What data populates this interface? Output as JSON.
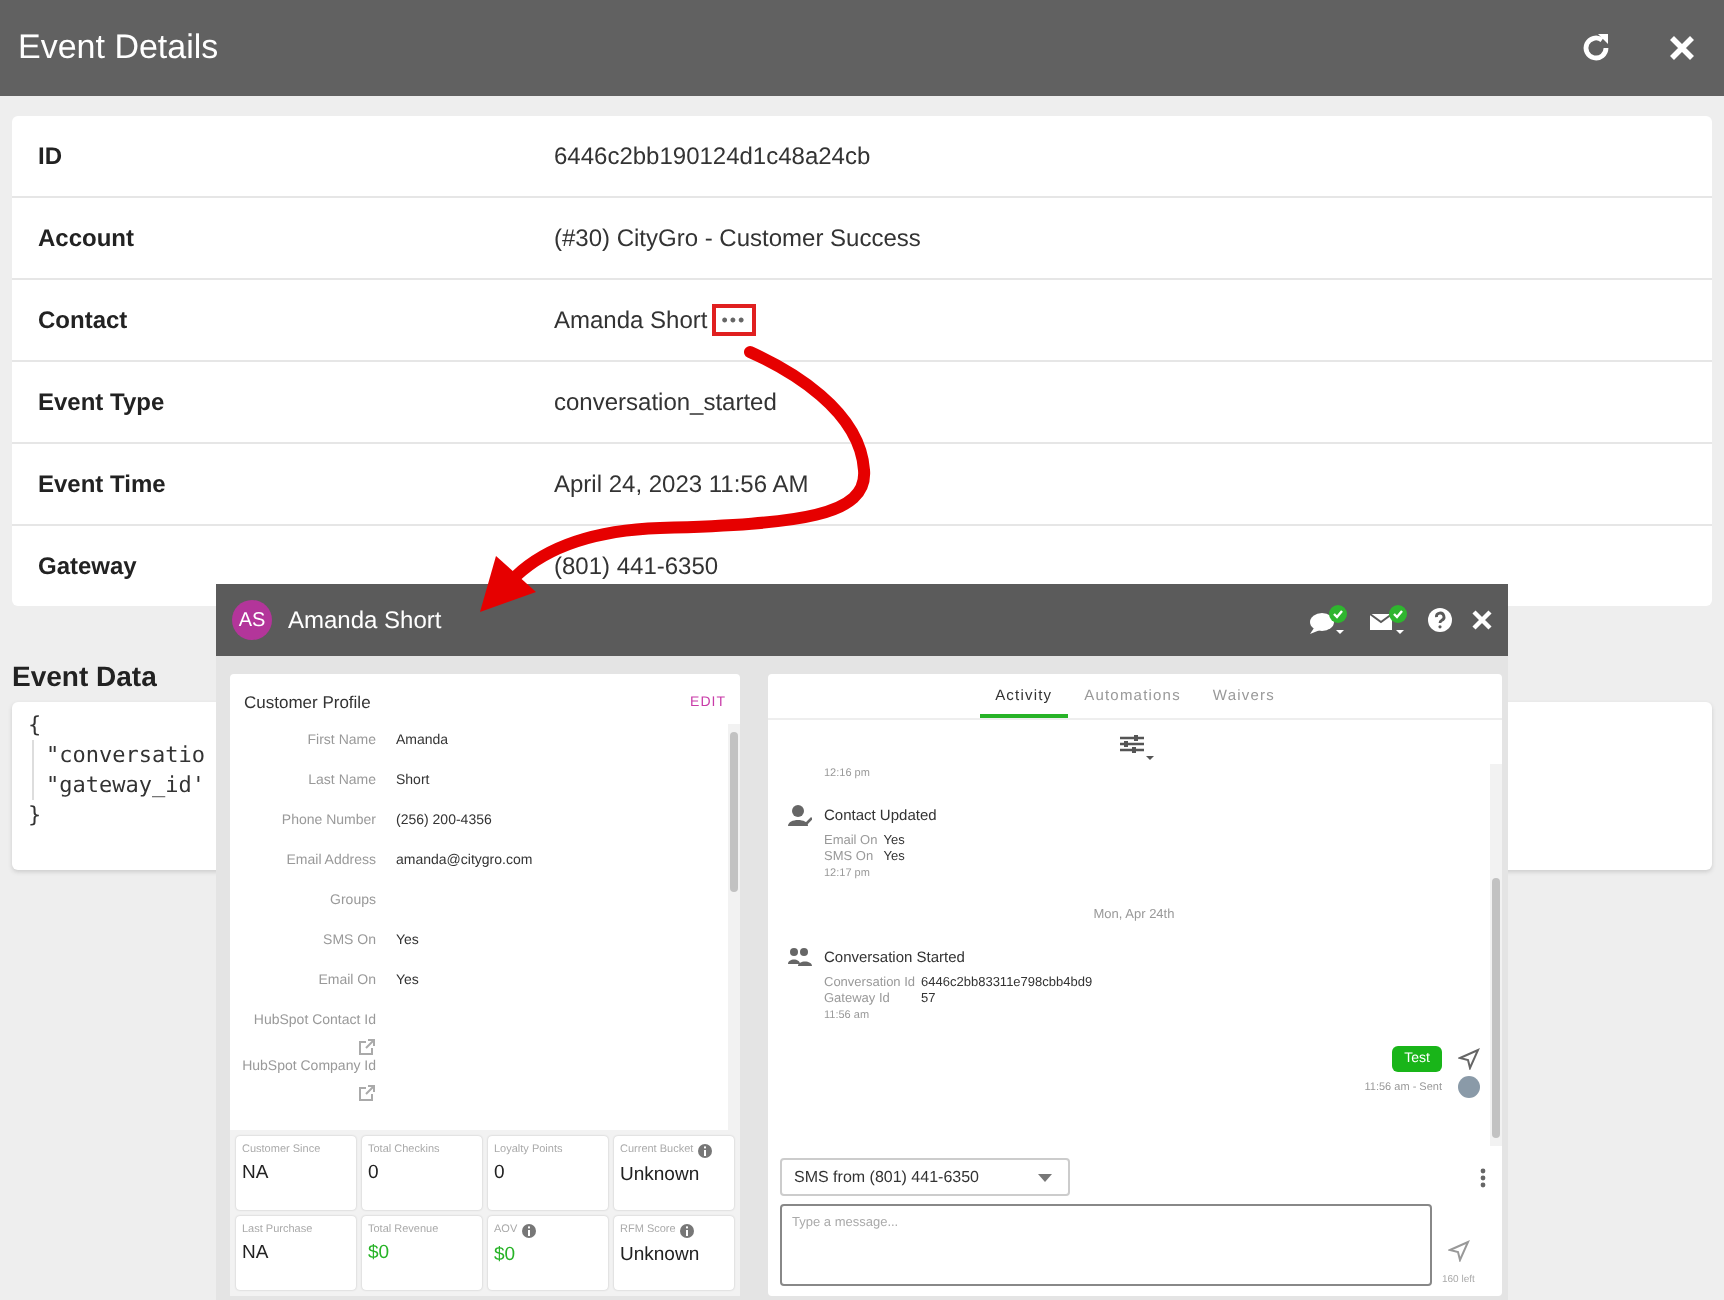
{
  "window": {
    "title": "Event Details"
  },
  "details": [
    {
      "label": "ID",
      "value": "6446c2bb190124d1c48a24cb"
    },
    {
      "label": "Account",
      "value": "(#30) CityGro - Customer Success"
    },
    {
      "label": "Contact",
      "value": "Amanda Short",
      "more": {
        "icon": "•••",
        "highlighted": true
      }
    },
    {
      "label": "Event Type",
      "value": "conversation_started"
    },
    {
      "label": "Event Time",
      "value": "April 24, 2023 11:56 AM"
    },
    {
      "label": "Gateway",
      "value": "(801) 441-6350"
    }
  ],
  "event_data": {
    "title": "Event Data",
    "lines": [
      "{",
      "\"conversatio",
      "\"gateway_id'",
      "}"
    ]
  },
  "contact_panel": {
    "initials": "AS",
    "name": "Amanda Short",
    "profile": {
      "title": "Customer Profile",
      "edit": "EDIT",
      "fields": [
        {
          "label": "First Name",
          "value": "Amanda"
        },
        {
          "label": "Last Name",
          "value": "Short"
        },
        {
          "label": "Phone Number",
          "value": "(256) 200-4356"
        },
        {
          "label": "Email Address",
          "value": "amanda@citygro.com"
        },
        {
          "label": "Groups"
        },
        {
          "label": "SMS On",
          "value": "Yes"
        },
        {
          "label": "Email On",
          "value": "Yes"
        },
        {
          "label": "HubSpot Contact Id",
          "link": true
        },
        {
          "label": "HubSpot Company Id",
          "link": true
        }
      ],
      "stats": [
        {
          "label": "Customer Since",
          "value": "NA",
          "kind": "text",
          "info": false
        },
        {
          "label": "Total Checkins",
          "value": "0",
          "kind": "text",
          "info": false
        },
        {
          "label": "Loyalty Points",
          "value": "0",
          "kind": "text",
          "info": false
        },
        {
          "label": "Current Bucket",
          "value": "Unknown",
          "kind": "text",
          "info": true
        },
        {
          "label": "Last Purchase",
          "value": "NA",
          "kind": "text",
          "info": false
        },
        {
          "label": "Total Revenue",
          "value": "$0",
          "kind": "money",
          "info": false
        },
        {
          "label": "AOV",
          "value": "$0",
          "kind": "money",
          "info": true
        },
        {
          "label": "RFM Score",
          "value": "Unknown",
          "kind": "text",
          "info": true
        }
      ]
    },
    "tabs": [
      {
        "label": "Activity",
        "selected": true
      },
      {
        "label": "Automations",
        "selected": false
      },
      {
        "label": "Waivers",
        "selected": false
      }
    ],
    "feed": [
      {
        "kind": "time",
        "time": "12:16 pm"
      },
      {
        "kind": "update",
        "title": "Contact Updated",
        "rows": [
          {
            "label": "Email On",
            "value": "Yes"
          },
          {
            "label": "SMS On",
            "value": "Yes"
          }
        ],
        "time": "12:17 pm"
      },
      {
        "kind": "date",
        "text": "Mon, Apr 24th"
      },
      {
        "kind": "conversation",
        "title": "Conversation Started",
        "rows": [
          {
            "label": "Conversation Id",
            "value": "6446c2bb83311e798cbb4bd9"
          },
          {
            "label": "Gateway Id",
            "value": "57"
          }
        ],
        "time": "11:56 am"
      },
      {
        "kind": "message",
        "text": "Test",
        "meta": "11:56 am - Sent"
      }
    ],
    "composer": {
      "channel": "SMS from (801) 441-6350",
      "placeholder": "Type a message...",
      "remaining": "160 left"
    }
  }
}
